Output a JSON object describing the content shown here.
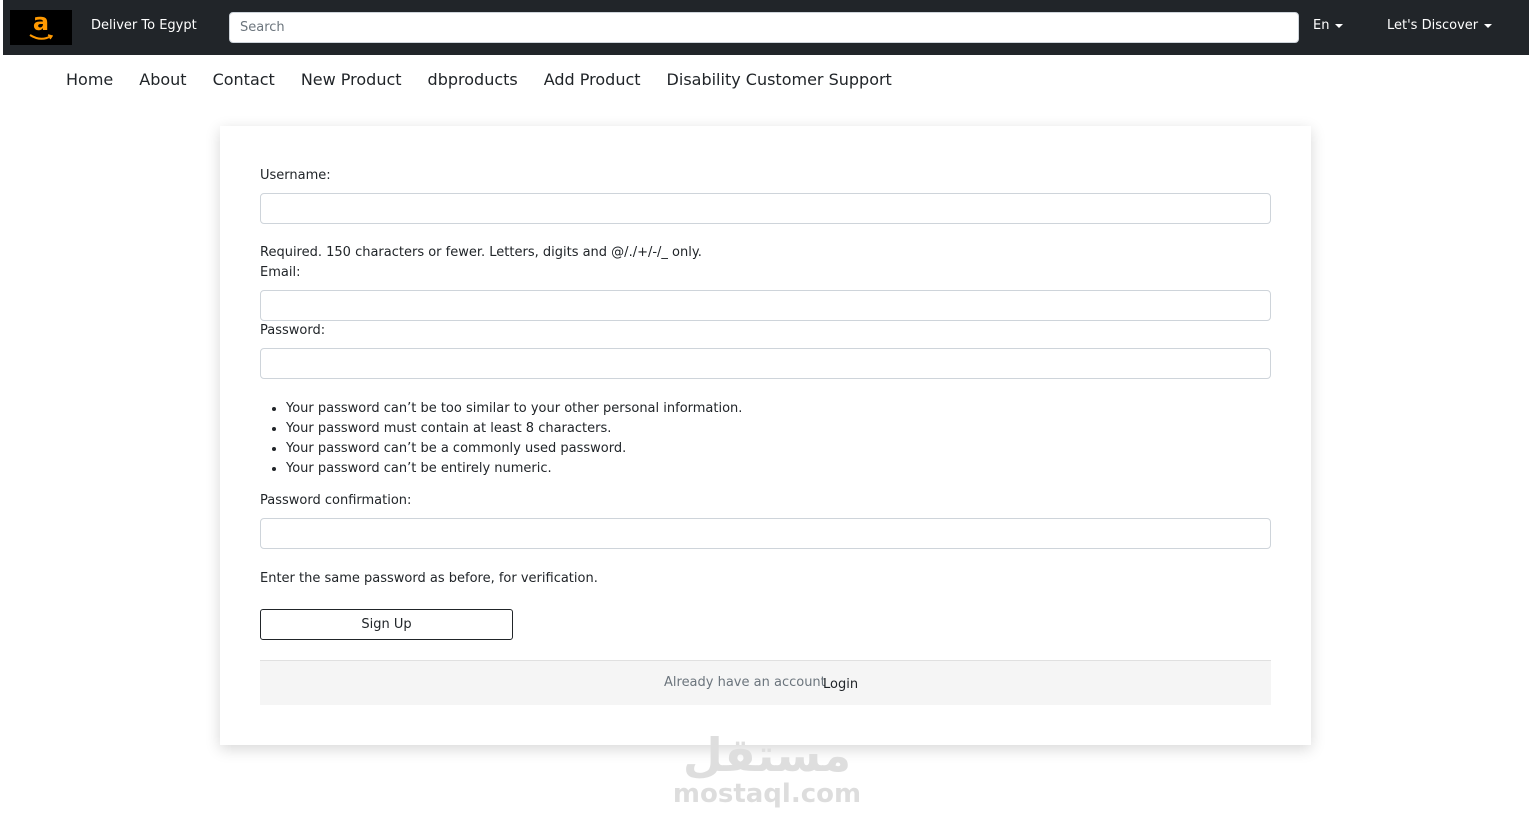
{
  "header": {
    "logo_letter": "a",
    "deliver_to": "Deliver To Egypt",
    "search_placeholder": "Search",
    "language": "En",
    "discover": "Let's Discover"
  },
  "nav": {
    "items": [
      "Home",
      "About",
      "Contact",
      "New Product",
      "dbproducts",
      "Add Product",
      "Disability Customer Support"
    ]
  },
  "form": {
    "username_label": "Username:",
    "username_value": "",
    "username_help": "Required. 150 characters or fewer. Letters, digits and @/./+/-/_ only.",
    "email_label": "Email:",
    "email_value": "",
    "password_label": "Password:",
    "password_value": "",
    "password_rules": [
      "Your password can’t be too similar to your other personal information.",
      "Your password must contain at least 8 characters.",
      "Your password can’t be a commonly used password.",
      "Your password can’t be entirely numeric."
    ],
    "confirm_label": "Password confirmation:",
    "confirm_value": "",
    "confirm_help": "Enter the same password as before, for verification.",
    "submit_label": "Sign Up",
    "already_text": "Already have an account",
    "login_label": "Login"
  },
  "watermark": {
    "arabic": "مستقل",
    "site": "mostaql.com"
  },
  "colors": {
    "topbar": "#212529",
    "logo_accent": "#ff9900"
  }
}
